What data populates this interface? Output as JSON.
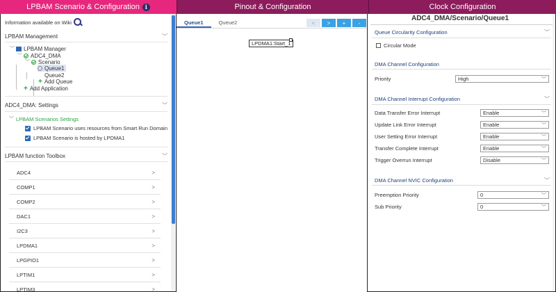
{
  "top_tabs": [
    {
      "label": "LPBAM Scenario & Configuration"
    },
    {
      "label": "Pinout & Configuration"
    },
    {
      "label": "Clock Configuration"
    }
  ],
  "info_icon_glyph": "i",
  "left": {
    "wiki_text": "Information available on Wiki",
    "management_header": "LPBAM Management",
    "tree": {
      "manager": "LPBAM Manager",
      "app": "ADC4_DMA",
      "scenario": "Scenario",
      "queue1": "Queue1",
      "queue2": "Queue2",
      "add_queue": "Add Queue",
      "add_application": "Add Application"
    },
    "settings_header": "ADC4_DMA: Settings",
    "settings_group": "LPBAM Scenarios Settings",
    "settings_options": [
      {
        "label": "LPBAM Scenario uses resources from Smart Run Domain",
        "checked": true
      },
      {
        "label": "LPBAM Scenario is hosted by LPDMA1",
        "checked": true
      }
    ],
    "toolbox_header": "LPBAM function Toolbox",
    "toolbox_items": [
      "ADC4",
      "COMP1",
      "COMP2",
      "DAC1",
      "I2C3",
      "LPDMA1",
      "LPGPIO1",
      "LPTIM1",
      "LPTIM3"
    ]
  },
  "middle": {
    "tabs": [
      "Queue1",
      "Queue2"
    ],
    "controls": [
      "<",
      ">",
      "+",
      "-"
    ],
    "node_label": "LPDMA1:Start_1"
  },
  "right": {
    "title": "ADC4_DMA/Scenario/Queue1",
    "circularity_header": "Queue Circularity Configuration",
    "circular_mode_label": "Circular Mode",
    "circular_mode_checked": false,
    "channel_header": "DMA Channel Configuration",
    "priority_label": "Priority",
    "priority_value": "High",
    "interrupt_header": "DMA Channel Interrupt Configuration",
    "interrupts": [
      {
        "label": "Data Transfer Error Interrupt",
        "value": "Enable"
      },
      {
        "label": "Update Link Error Interrupt",
        "value": "Enable"
      },
      {
        "label": "User Setting Error Interrupt",
        "value": "Enable"
      },
      {
        "label": "Transfer Complete Interrupt",
        "value": "Enable"
      },
      {
        "label": "Trigger Overrun Interrupt",
        "value": "Disable"
      }
    ],
    "nvic_header": "DMA Channel NVIC Configuration",
    "preemption_label": "Preemption Priority",
    "preemption_value": "0",
    "sub_priority_label": "Sub Priority",
    "sub_priority_value": "0"
  },
  "colors": {
    "active_tab": "#e7277d",
    "inactive_tab": "#8d1c5c",
    "accent_blue": "#2d68b5",
    "green": "#2aa344"
  }
}
